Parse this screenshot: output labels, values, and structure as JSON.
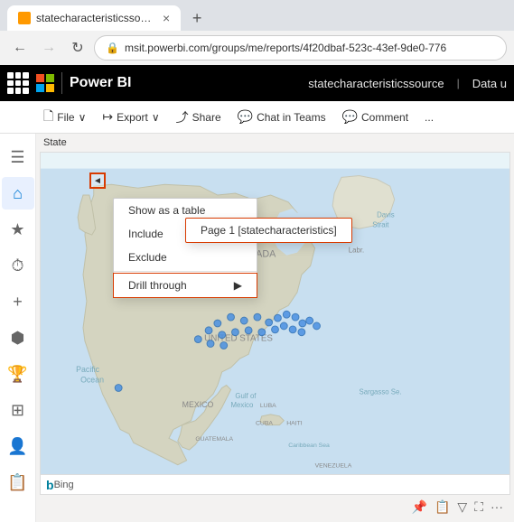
{
  "browser": {
    "tab_title": "statecharacteristicssource - Powe",
    "new_tab_label": "+",
    "back_disabled": false,
    "forward_disabled": true,
    "address": "msit.powerbi.com/groups/me/reports/4f20dbaf-523c-43ef-9de0-776"
  },
  "header": {
    "product": "Power BI",
    "report_name": "statecharacteristicssource",
    "separator": "|",
    "data_label": "Data u"
  },
  "toolbar": {
    "file_label": "File",
    "export_label": "Export",
    "share_label": "Share",
    "chat_label": "Chat in Teams",
    "comment_label": "Comment",
    "more_label": "..."
  },
  "content": {
    "state_label": "State"
  },
  "context_menu": {
    "show_as_table": "Show as a table",
    "include": "Include",
    "exclude": "Exclude",
    "drill_through": "Drill through",
    "arrow": "▶"
  },
  "submenu": {
    "page1": "Page 1 [statecharacteristics]"
  },
  "map": {
    "bing_b": "b",
    "bing_text": "Bing"
  },
  "bottom_toolbar": {
    "icons": [
      "📌",
      "📋",
      "▽",
      "⛶",
      "..."
    ]
  },
  "sidebar": {
    "icons": [
      "≡",
      "⌂",
      "★",
      "⏱",
      "+",
      "⬡",
      "🏆",
      "⊞",
      "👤",
      "📋"
    ]
  }
}
